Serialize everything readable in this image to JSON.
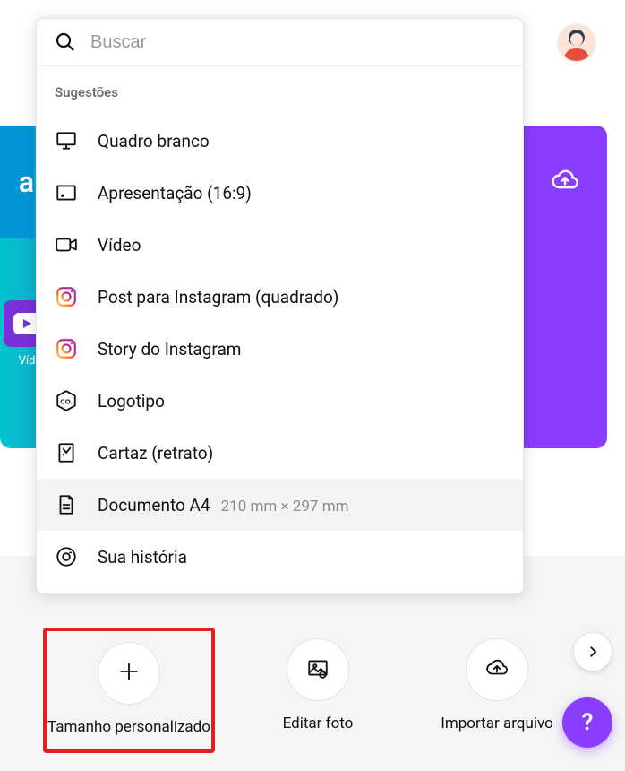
{
  "search": {
    "placeholder": "Buscar"
  },
  "suggestions_header": "Sugestões",
  "suggestions": [
    {
      "label": "Quadro branco",
      "icon": "whiteboard",
      "hovered": false
    },
    {
      "label": "Apresentação (16:9)",
      "icon": "presentation",
      "hovered": false
    },
    {
      "label": "Vídeo",
      "icon": "video",
      "hovered": false
    },
    {
      "label": "Post para Instagram (quadrado)",
      "icon": "instagram",
      "hovered": false
    },
    {
      "label": "Story do Instagram",
      "icon": "instagram",
      "hovered": false
    },
    {
      "label": "Logotipo",
      "icon": "logo",
      "hovered": false
    },
    {
      "label": "Cartaz (retrato)",
      "icon": "poster",
      "hovered": false
    },
    {
      "label": "Documento A4",
      "secondary": "210 mm × 297 mm",
      "icon": "document",
      "hovered": true
    },
    {
      "label": "Sua história",
      "icon": "camera",
      "hovered": false
    }
  ],
  "background": {
    "item_blue_text": "a",
    "item_purple_label": "Víd"
  },
  "actions": [
    {
      "label": "Tamanho personalizado",
      "icon": "plus",
      "highlighted": true
    },
    {
      "label": "Editar foto",
      "icon": "photo",
      "highlighted": false
    },
    {
      "label": "Importar arquivo",
      "icon": "cloud-upload",
      "highlighted": false
    }
  ],
  "help_label": "?",
  "colors": {
    "accent": "#8b3dff",
    "highlight_border": "#e02020"
  }
}
